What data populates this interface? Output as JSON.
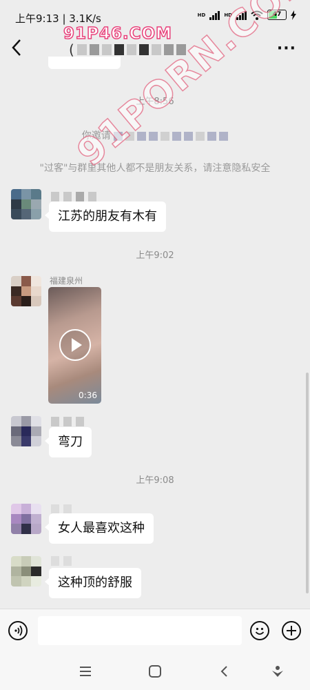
{
  "status": {
    "time": "上午9:13",
    "speed": "| 3.1K/s",
    "hd1": "HD",
    "hd2": "HD",
    "battery": "47"
  },
  "watermarks": {
    "top": "91P46.COM",
    "diagonal": "91PORN.COM"
  },
  "chat": {
    "time1": "上午8:56",
    "invite_prefix": "你邀请",
    "privacy_notice": "\"过客\"与群里其他人都不是朋友关系，请注意隐私安全",
    "msg1": "江苏的朋友有木有",
    "time2": "上午9:02",
    "sender2_name": "福建泉州",
    "video_duration": "0:36",
    "msg3": "弯刀",
    "time3": "上午9:08",
    "msg4": "女人最喜欢这种",
    "msg5": "这种顶的舒服"
  },
  "colors": {
    "background": "#ededed",
    "bubble": "#ffffff",
    "battery_fill": "#4cd964"
  }
}
